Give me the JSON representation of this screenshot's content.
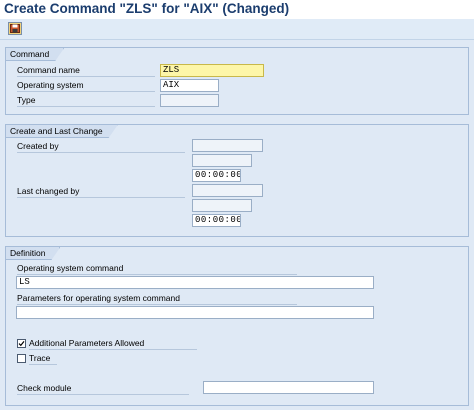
{
  "window": {
    "title": "Create Command \"ZLS\" for \"AIX\" (Changed)"
  },
  "toolbar": {
    "save_icon": "save-icon"
  },
  "command_group": {
    "title": "Command",
    "command_name_label": "Command name",
    "command_name_value": "ZLS",
    "os_label": "Operating system",
    "os_value": "AIX",
    "type_label": "Type",
    "type_value": ""
  },
  "change_group": {
    "title": "Create and Last Change",
    "created_by_label": "Created by",
    "created_by_value": "",
    "created_date_value": "",
    "created_time_value": "00:00:00",
    "last_changed_label": "Last changed by",
    "last_changed_value": "",
    "last_changed_date_value": "",
    "last_changed_time_value": "00:00:00"
  },
  "definition_group": {
    "title": "Definition",
    "os_command_label": "Operating system command",
    "os_command_value": "LS",
    "params_label": "Parameters for operating system command",
    "params_value": "",
    "additional_params_label": "Additional Parameters Allowed",
    "additional_params_checked": true,
    "trace_label": "Trace",
    "trace_checked": false,
    "check_module_label": "Check module",
    "check_module_value": ""
  },
  "colors": {
    "title": "#1b3d6e",
    "background": "#dfe9f5",
    "active_field": "#fdf6a8"
  }
}
